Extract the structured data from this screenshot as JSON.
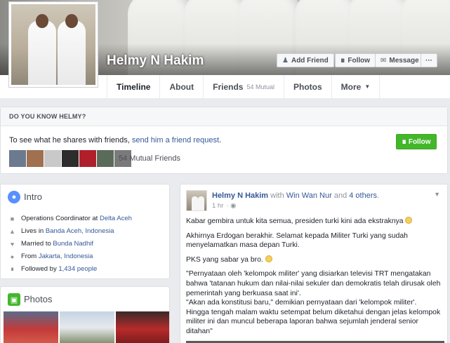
{
  "profile": {
    "name": "Helmy N Hakim"
  },
  "cover_buttons": {
    "add_friend": "Add Friend",
    "follow": "Follow",
    "message": "Message",
    "more": "···"
  },
  "tabs": [
    {
      "label": "Timeline"
    },
    {
      "label": "About"
    },
    {
      "label": "Friends",
      "count": "54 Mutual"
    },
    {
      "label": "Photos"
    },
    {
      "label": "More"
    }
  ],
  "know_box": {
    "heading": "DO YOU KNOW HELMY?",
    "text_prefix": "To see what he shares with friends, ",
    "link": "send him a friend request",
    "text_suffix": ".",
    "follow_label": "Follow",
    "mutual_label": "54 Mutual Friends",
    "mutual_colors": [
      "#6b7a8f",
      "#a07050",
      "#c9c9c9",
      "#2d2d2d",
      "#b0202a",
      "#5a6b5a",
      "#7a7a7a"
    ]
  },
  "intro": {
    "title": "Intro",
    "items": [
      {
        "icon": "briefcase-icon",
        "prefix": "Operations Coordinator at ",
        "link": "Delta Aceh"
      },
      {
        "icon": "home-icon",
        "prefix": "Lives in ",
        "link": "Banda Aceh, Indonesia"
      },
      {
        "icon": "heart-icon",
        "prefix": "Married to ",
        "link": "Bunda Nadhif"
      },
      {
        "icon": "location-pin-icon",
        "prefix": "From ",
        "link": "Jakarta, Indonesia"
      },
      {
        "icon": "rss-icon",
        "prefix": "Followed by ",
        "link": "1,434 people"
      }
    ]
  },
  "photos": {
    "title": "Photos"
  },
  "post": {
    "author": "Helmy N Hakim",
    "with_text": " with ",
    "with_name": "Win Wan Nur",
    "and_text": " and ",
    "others": "4 others",
    "period": ".",
    "time": "1 hr",
    "lines": [
      "Kabar gembira untuk kita semua, presiden turki kini ada ekstraknya",
      "Akhirnya Erdogan berakhir. Selamat kepada Militer Turki yang sudah menyelamatkan masa depan Turki.",
      "PKS yang sabar ya bro.",
      "\"Pernyataan oleh 'kelompok militer' yang disiarkan televisi TRT mengatakan bahwa 'tatanan hukum dan nilai-nilai sekuler dan demokratis telah dirusak oleh pemerintah yang berkuasa saat ini'.",
      "\"Akan ada konstitusi baru,\" demikian pernyataan dari 'kelompok militer'.",
      "Hingga tengah malam waktu setempat belum diketahui dengan jelas kelompok militer ini dan muncul beberapa laporan bahwa sejumlah jenderal senior ditahan\""
    ]
  }
}
